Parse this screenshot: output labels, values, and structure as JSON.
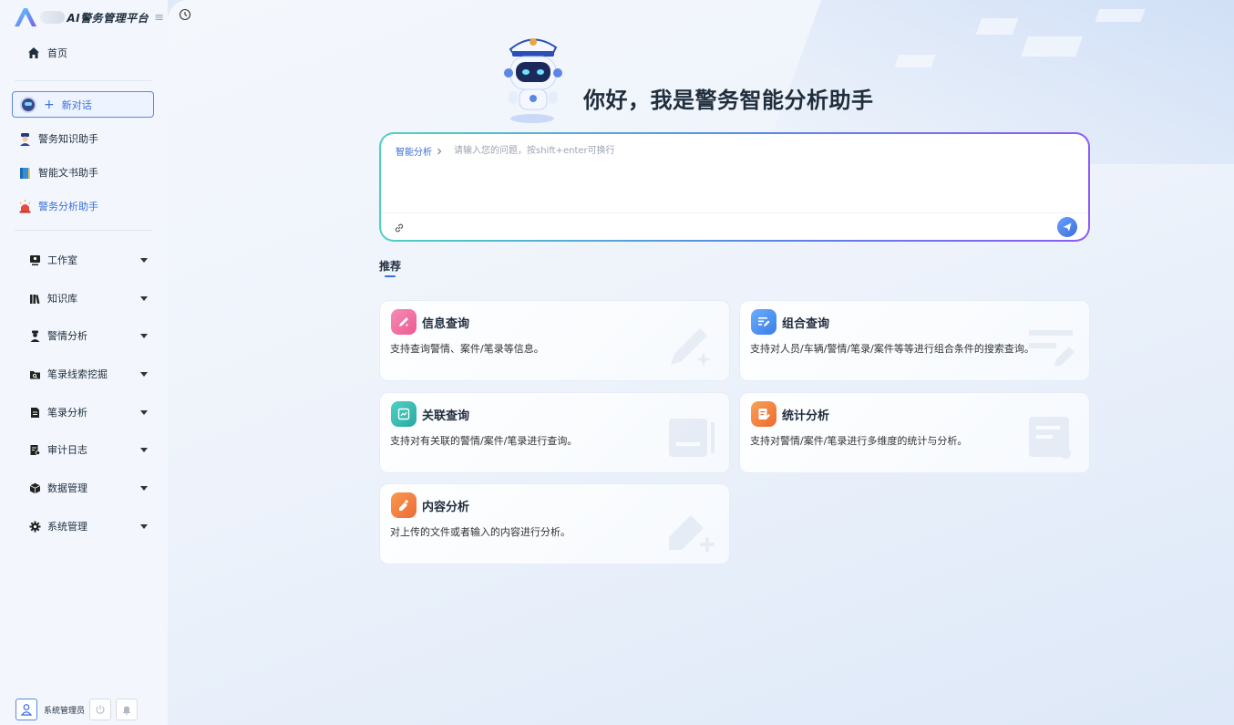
{
  "app": {
    "title": "AI警务管理平台",
    "logo_letter": "A"
  },
  "sidebar": {
    "home": "首页",
    "new_chat": "新对话",
    "assistants": [
      {
        "label": "警务知识助手",
        "icon": "police-officer-icon"
      },
      {
        "label": "智能文书助手",
        "icon": "book-icon"
      },
      {
        "label": "警务分析助手",
        "icon": "siren-icon",
        "active": true
      }
    ],
    "groups": [
      {
        "label": "工作室",
        "icon": "monitor-user-icon"
      },
      {
        "label": "知识库",
        "icon": "books-icon"
      },
      {
        "label": "警情分析",
        "icon": "officer-icon"
      },
      {
        "label": "笔录线索挖掘",
        "icon": "folder-search-icon"
      },
      {
        "label": "笔录分析",
        "icon": "document-icon"
      },
      {
        "label": "审计日志",
        "icon": "audit-log-icon"
      },
      {
        "label": "数据管理",
        "icon": "cube-icon"
      },
      {
        "label": "系统管理",
        "icon": "gear-icon"
      }
    ],
    "user": "系统管理员"
  },
  "main": {
    "greeting": "你好，我是警务智能分析助手",
    "mode_tag": "智能分析",
    "input_placeholder": "请输入您的问题，按shift+enter可换行",
    "recommend_title": "推荐",
    "cards": [
      {
        "title": "信息查询",
        "desc": "支持查询警情、案件/笔录等信息。",
        "color": "#f06ba0"
      },
      {
        "title": "组合查询",
        "desc": "支持对人员/车辆/警情/笔录/案件等等进行组合条件的搜索查询。",
        "color": "#4a8ef0"
      },
      {
        "title": "关联查询",
        "desc": "支持对有关联的警情/案件/笔录进行查询。",
        "color": "#2fb8b0"
      },
      {
        "title": "统计分析",
        "desc": "支持对警情/案件/笔录进行多维度的统计与分析。",
        "color": "#f07a3a"
      },
      {
        "title": "内容分析",
        "desc": "对上传的文件或者输入的内容进行分析。",
        "color": "#f0853a"
      }
    ]
  },
  "colors": {
    "accent": "#3b6fd8",
    "sidebar_bg": "#f3f7fd"
  }
}
